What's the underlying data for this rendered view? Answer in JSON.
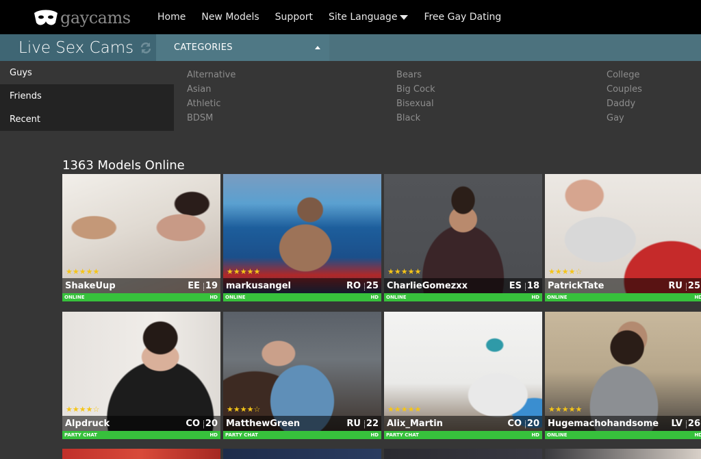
{
  "brand": {
    "logo_text": "gaycams"
  },
  "nav": {
    "home": "Home",
    "new_models": "New Models",
    "support": "Support",
    "site_language": "Site Language",
    "free_dating": "Free Gay Dating"
  },
  "subbar": {
    "title": "Live Sex Cams",
    "categories_tab": "CATEGORIES"
  },
  "left_menu": [
    "Guys",
    "Friends",
    "Recent"
  ],
  "categories": {
    "col1": [
      "Alternative",
      "Asian",
      "Athletic",
      "BDSM"
    ],
    "col2": [
      "Bears",
      "Big Cock",
      "Bisexual",
      "Black"
    ],
    "col3": [
      "College",
      "Couples",
      "Daddy",
      "Gay"
    ]
  },
  "models_title": "1363 Models Online",
  "models": [
    {
      "name": "ShakeUup",
      "country": "EE",
      "age": "19",
      "status": "ONLINE",
      "quality": "HD",
      "stars": "★★★★★"
    },
    {
      "name": "markusangel",
      "country": "RO",
      "age": "25",
      "status": "ONLINE",
      "quality": "HD",
      "stars": "★★★★★"
    },
    {
      "name": "CharlieGomezxx",
      "country": "ES",
      "age": "18",
      "status": "ONLINE",
      "quality": "HD",
      "stars": "★★★★★"
    },
    {
      "name": "PatrickTate",
      "country": "RU",
      "age": "25",
      "status": "ONLINE",
      "quality": "HD",
      "stars": "★★★★☆"
    },
    {
      "name": "Alpdruck",
      "country": "CO",
      "age": "20",
      "status": "PARTY CHAT",
      "quality": "HD",
      "stars": "★★★★☆"
    },
    {
      "name": "MatthewGreen",
      "country": "RU",
      "age": "22",
      "status": "PARTY CHAT",
      "quality": "HD",
      "stars": "★★★★☆"
    },
    {
      "name": "Alix_Martin",
      "country": "CO",
      "age": "20",
      "status": "PARTY CHAT",
      "quality": "HD",
      "stars": "★★★★★"
    },
    {
      "name": "Hugemachohandsome",
      "country": "LV",
      "age": "26",
      "status": "ONLINE",
      "quality": "HD",
      "stars": "★★★★★"
    }
  ],
  "colors": {
    "topbar": "#000000",
    "subbar": "#4f7885",
    "status_green": "#37c13c",
    "star_gold": "#f5c518",
    "background": "#363636"
  },
  "icons": {
    "logo": "mask-icon",
    "refresh": "refresh-icon",
    "site_language_caret": "caret-down-icon",
    "categories_caret": "caret-up-icon"
  }
}
